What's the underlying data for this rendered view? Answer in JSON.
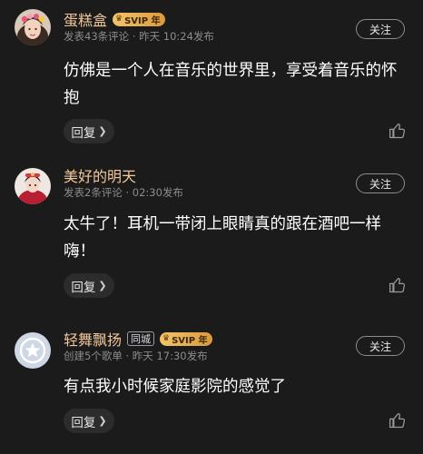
{
  "comments": [
    {
      "username": "蛋糕盒",
      "svip_badge": "SVIP 年",
      "meta": "发表43条评论 · 昨天 10:24发布",
      "follow_label": "关注",
      "content": "仿佛是一个人在音乐的世界里，享受着音乐的怀抱",
      "reply_label": "回复",
      "avatar_icon": "avatar-photo-woman-flower-crown"
    },
    {
      "username": "美好的明天",
      "meta": "发表2条评论 · 02:30发布",
      "follow_label": "关注",
      "content": "太牛了！耳机一带闭上眼睛真的跟在酒吧一样嗨！",
      "reply_label": "回复",
      "avatar_icon": "avatar-photo-red-costume"
    },
    {
      "username": "轻舞飘扬",
      "city_badge": "同城",
      "svip_badge": "SVIP 年",
      "meta": "创建5个歌单 · 昨天 17:30发布",
      "follow_label": "关注",
      "content": "有点我小时候家庭影院的感觉了",
      "reply_label": "回复",
      "avatar_icon": "default-star-avatar"
    }
  ],
  "colors": {
    "background": "#1b1b1b",
    "username": "#f1c79a",
    "meta": "#8c8c8c",
    "svip_gold": "#f3c46a"
  },
  "icons": {
    "like": "thumbs-up-icon",
    "chevron": "chevron-right-icon",
    "crown": "crown-icon"
  }
}
